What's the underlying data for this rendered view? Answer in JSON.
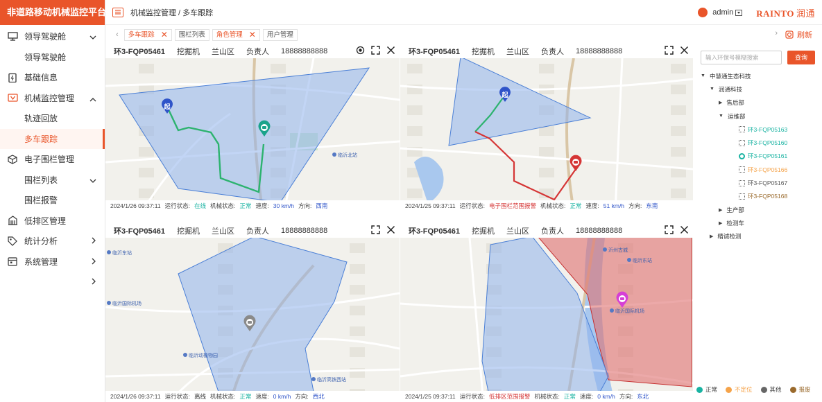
{
  "app_title": "非道路移动机械监控平台",
  "breadcrumb": "机械监控管理 / 多车跟踪",
  "user": {
    "name": "admin"
  },
  "logo": {
    "en": "RAINTO",
    "cn": "润通"
  },
  "sidebar": {
    "items": [
      {
        "label": "领导驾驶舱"
      },
      {
        "label": "领导驾驶舱"
      },
      {
        "label": "基础信息"
      },
      {
        "label": "机械监控管理"
      },
      {
        "label": "轨迹回放"
      },
      {
        "label": "多车跟踪"
      },
      {
        "label": "电子围栏管理"
      },
      {
        "label": "围栏列表"
      },
      {
        "label": "围栏报警"
      },
      {
        "label": "低排区管理"
      },
      {
        "label": "统计分析"
      },
      {
        "label": "系统管理"
      }
    ]
  },
  "tabs": [
    {
      "label": "多车跟踪"
    },
    {
      "label": "围栏列表"
    },
    {
      "label": "角色管理"
    },
    {
      "label": "用户管理"
    }
  ],
  "refresh_label": "刷新",
  "panels": [
    {
      "plate": "环3-FQP05461",
      "type": "挖掘机",
      "area": "兰山区",
      "owner_label": "负责人",
      "phone": "18888888888",
      "time": "2024/1/26 09:37:11",
      "run_label": "运行状态:",
      "run": "在线",
      "mech_label": "机械状态:",
      "mech": "正常",
      "speed_label": "速度:",
      "speed": "30 km/h",
      "dir_label": "方向:",
      "dir": "西南"
    },
    {
      "plate": "环3-FQP05461",
      "type": "挖掘机",
      "area": "兰山区",
      "owner_label": "负责人",
      "phone": "18888888888",
      "time": "2024/1/25 09:37:11",
      "run_label": "运行状态:",
      "run": "电子围栏范围报警",
      "mech_label": "机械状态:",
      "mech": "正常",
      "speed_label": "速度:",
      "speed": "51 km/h",
      "dir_label": "方向:",
      "dir": "东南"
    },
    {
      "plate": "环3-FQP05461",
      "type": "挖掘机",
      "area": "兰山区",
      "owner_label": "负责人",
      "phone": "18888888888",
      "time": "2024/1/26 09:37:11",
      "run_label": "运行状态:",
      "run": "离线",
      "mech_label": "机械状态:",
      "mech": "正常",
      "speed_label": "速度:",
      "speed": "0 km/h",
      "dir_label": "方向:",
      "dir": "西北"
    },
    {
      "plate": "环3-FQP05461",
      "type": "挖掘机",
      "area": "兰山区",
      "owner_label": "负责人",
      "phone": "18888888888",
      "time": "2024/1/25 09:37:11",
      "run_label": "运行状态:",
      "run": "低排区范围报警",
      "mech_label": "机械状态:",
      "mech": "正常",
      "speed_label": "速度:",
      "speed": "0 km/h",
      "dir_label": "方向:",
      "dir": "东北"
    }
  ],
  "map_labels": {
    "start": "起",
    "p1": [
      "临沂北站",
      "沂州古城"
    ],
    "p3": [
      "临沂东站",
      "临沂国际机场",
      "临沂动植物园",
      "临沂高铁西站"
    ],
    "p4": [
      "沂州古城",
      "临沂东站",
      "临沂国际机场"
    ]
  },
  "search": {
    "placeholder": "输入环保号模糊搜索",
    "button": "查询"
  },
  "tree": [
    {
      "label": "中慧通生态科技",
      "level": 0,
      "toggle": "▼"
    },
    {
      "label": "润通科技",
      "level": 1,
      "toggle": "▼"
    },
    {
      "label": "售后部",
      "level": 2,
      "toggle": "▶"
    },
    {
      "label": "运维部",
      "level": 2,
      "toggle": "▼"
    },
    {
      "label": "环3-FQP05163",
      "level": 3,
      "status": "normal"
    },
    {
      "label": "环3-FQP05160",
      "level": 3,
      "status": "normal"
    },
    {
      "label": "环3-FQP05161",
      "level": 3,
      "status": "selected"
    },
    {
      "label": "环3-FQP05166",
      "level": 3,
      "status": "unlocated"
    },
    {
      "label": "环3-FQP05167",
      "level": 3,
      "status": "other"
    },
    {
      "label": "环3-FQP05168",
      "level": 3,
      "status": "scrapped"
    },
    {
      "label": "生产部",
      "level": 2,
      "toggle": "▶"
    },
    {
      "label": "检测车",
      "level": 2,
      "toggle": "▶"
    },
    {
      "label": "精诚检测",
      "level": 1,
      "toggle": "▶"
    }
  ],
  "legend": [
    {
      "label": "正常",
      "color": "#19b3a2"
    },
    {
      "label": "不定位",
      "color": "#f5a34a"
    },
    {
      "label": "其他",
      "color": "#666666"
    },
    {
      "label": "报废",
      "color": "#9a6a2c"
    }
  ],
  "colors": {
    "accent": "#e9552a",
    "fence": "#8fb3ec",
    "alarm": "#e07070"
  }
}
